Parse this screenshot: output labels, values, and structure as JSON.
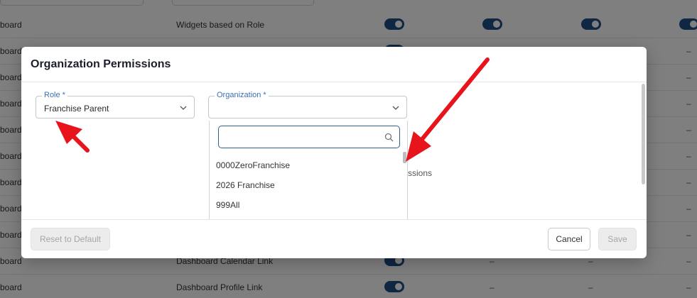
{
  "background": {
    "rows": [
      {
        "prefix": "board",
        "name": "Widgets based on Role",
        "cells": [
          "toggle",
          "toggle",
          "toggle",
          "toggle"
        ]
      },
      {
        "prefix": "board",
        "name": "",
        "cells": [
          "toggle",
          "",
          "",
          "–"
        ]
      },
      {
        "prefix": "board",
        "name": "",
        "cells": [
          "",
          "",
          "",
          "–"
        ]
      },
      {
        "prefix": "board",
        "name": "",
        "cells": [
          "",
          "",
          "",
          "–"
        ]
      },
      {
        "prefix": "board",
        "name": "",
        "cells": [
          "",
          "",
          "",
          "–"
        ]
      },
      {
        "prefix": "board",
        "name": "",
        "cells": [
          "",
          "",
          "",
          "–"
        ]
      },
      {
        "prefix": "board",
        "name": "",
        "cells": [
          "",
          "",
          "",
          "–"
        ]
      },
      {
        "prefix": "board",
        "name": "",
        "cells": [
          "",
          "",
          "",
          "–"
        ]
      },
      {
        "prefix": "board",
        "name": "",
        "cells": [
          "",
          "",
          "",
          "–"
        ]
      },
      {
        "prefix": "board",
        "name": "Dashboard Calendar Link",
        "cells": [
          "toggle",
          "–",
          "–",
          "–"
        ]
      },
      {
        "prefix": "board",
        "name": "Dashboard Profile Link",
        "cells": [
          "toggle",
          "–",
          "–",
          "–"
        ]
      }
    ]
  },
  "modal": {
    "title": "Organization Permissions",
    "role": {
      "label": "Role *",
      "value": "Franchise Parent"
    },
    "organization": {
      "label": "Organization *",
      "value": ""
    },
    "search": {
      "placeholder": ""
    },
    "options": [
      "0000ZeroFranchise",
      "2026 Franchise",
      "999All"
    ],
    "partial_text": "ssions",
    "buttons": {
      "reset": "Reset to Default",
      "cancel": "Cancel",
      "save": "Save"
    }
  },
  "colors": {
    "accent": "#3a6fb5",
    "toggle": "#1f4f86",
    "annotation_arrow": "#e8141b"
  }
}
